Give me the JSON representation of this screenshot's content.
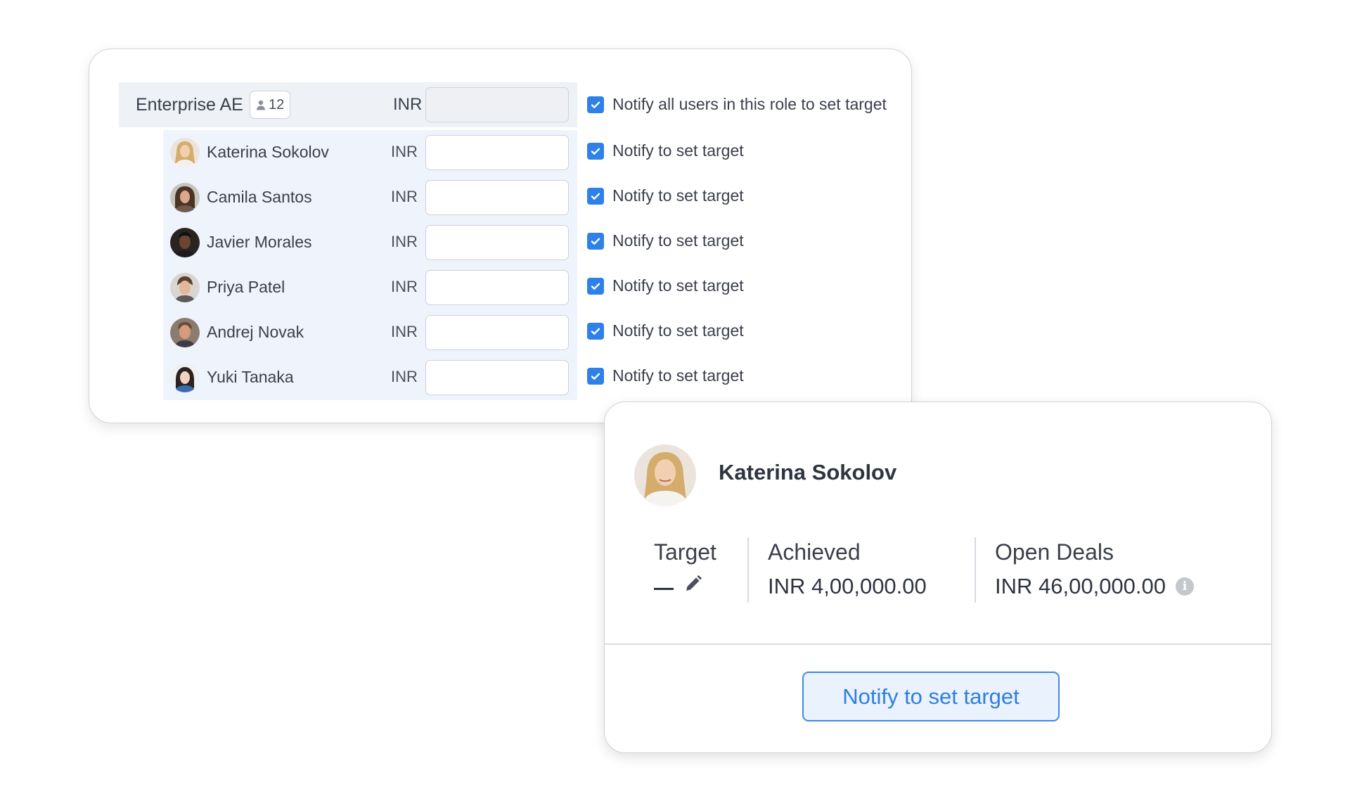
{
  "role": {
    "name": "Enterprise AE",
    "member_count": "12",
    "currency": "INR",
    "target_value": "",
    "notify_all_label": "Notify all users in this role to set target",
    "notify_all_checked": true
  },
  "users": [
    {
      "name": "Katerina Sokolov",
      "currency": "INR",
      "target_value": "",
      "notify_label": "Notify to set target",
      "notify_checked": true
    },
    {
      "name": "Camila Santos",
      "currency": "INR",
      "target_value": "",
      "notify_label": "Notify to set target",
      "notify_checked": true
    },
    {
      "name": "Javier Morales",
      "currency": "INR",
      "target_value": "",
      "notify_label": "Notify to set target",
      "notify_checked": true
    },
    {
      "name": "Priya Patel",
      "currency": "INR",
      "target_value": "",
      "notify_label": "Notify to set target",
      "notify_checked": true
    },
    {
      "name": "Andrej Novak",
      "currency": "INR",
      "target_value": "",
      "notify_label": "Notify to set target",
      "notify_checked": true
    },
    {
      "name": "Yuki Tanaka",
      "currency": "INR",
      "target_value": "",
      "notify_label": "Notify to set target",
      "notify_checked": true
    }
  ],
  "detail": {
    "name": "Katerina Sokolov",
    "target_label": "Target",
    "achieved_label": "Achieved",
    "achieved_value": "INR 4,00,000.00",
    "open_deals_label": "Open Deals",
    "open_deals_value": "INR 46,00,000.00",
    "notify_button": "Notify to set target",
    "icons": {
      "edit": "pencil-icon",
      "info": "info-icon"
    }
  },
  "colors": {
    "accent": "#2f80e8",
    "role_row_bg": "#eef1f6",
    "user_rows_bg": "#eef3fc",
    "button_bg": "#eaf2fd"
  }
}
